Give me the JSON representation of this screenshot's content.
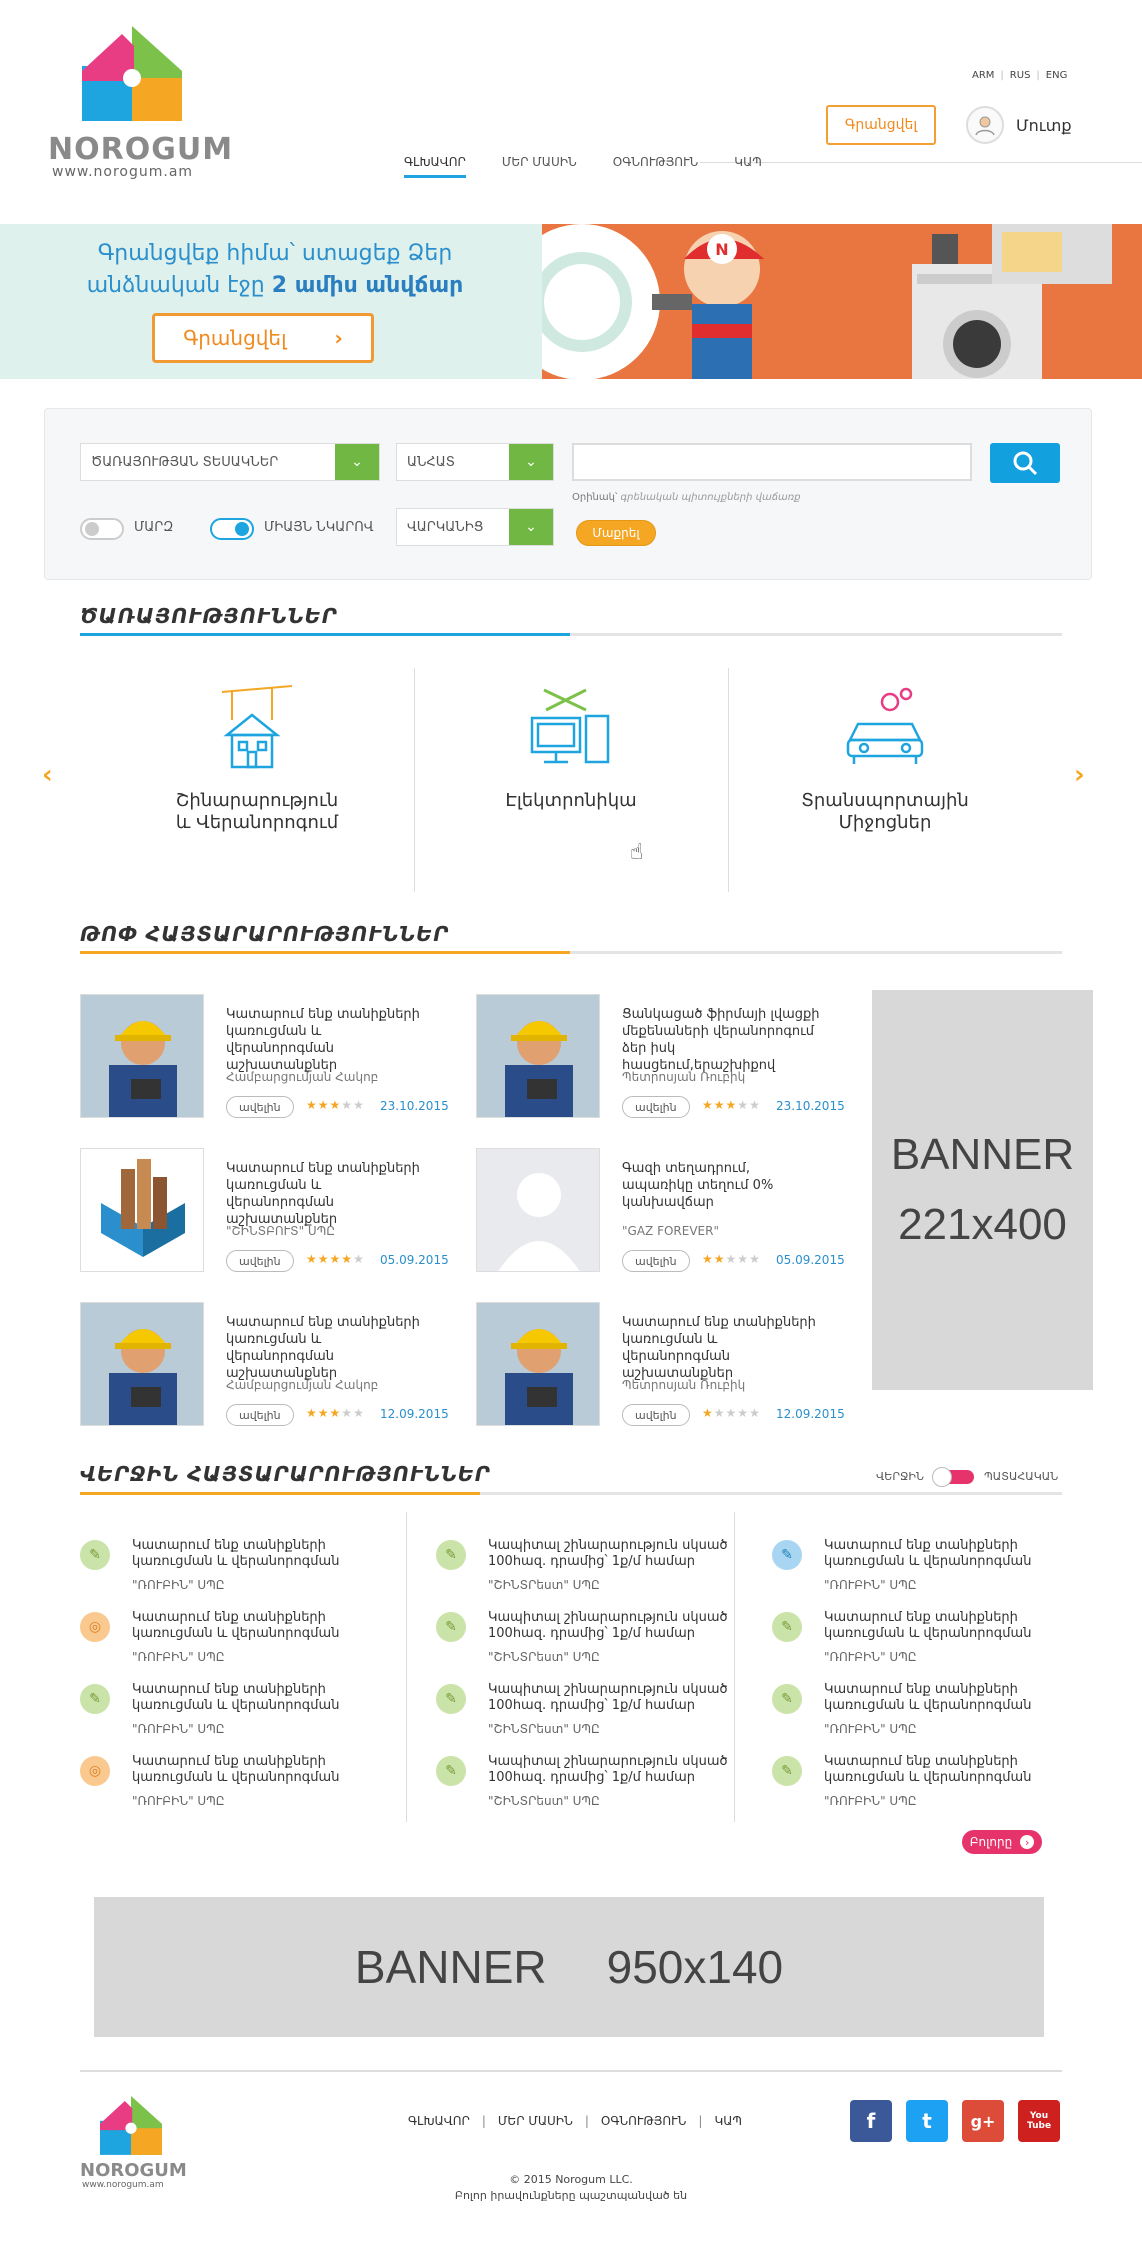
{
  "header": {
    "logo_text": "NOROGUM",
    "logo_url": "www.norogum.am",
    "langs": [
      "ARM",
      "RUS",
      "ENG"
    ],
    "register_label": "Գրանցվել",
    "login_label": "Մուտք",
    "nav": [
      "ԳԼԽԱՎՈՐ",
      "ՄԵՐ ՄԱՍԻՆ",
      "ՕԳՆՈՒԹՅՈՒՆ",
      "ԿԱՊ"
    ]
  },
  "hero": {
    "line1": "Գրանցվեք հիմա՝ ստացեք Ձեր",
    "line2_a": "անձնական էջը",
    "line2_b": "2 ամիս անվճար",
    "button": "Գրանցվել",
    "badge": "N"
  },
  "search": {
    "service_types": "ԾԱՌԱՅՈՒԹՅԱՆ ՏԵՍԱԿՆԵՐ",
    "region": "ԱՆՀԱՏ",
    "duration": "ՎԱՐԿԱՆԻՑ",
    "input_value": "",
    "hint_label": "Օրինակ՝",
    "hint_text": "գրենական պիտույքների վաճառք",
    "find_label": "Մաքրել",
    "toggle1_label": "ՄԱՐԶ",
    "toggle2_label": "ՄԻԱՅՆ ՆԿԱՐՈՎ"
  },
  "services": {
    "title": "ԾԱՌԱՅՈՒԹՅՈՒՆՆԵՐ",
    "items": [
      {
        "line1": "Շինարարություն",
        "line2": "և Վերանորոգում",
        "icon": "construction-icon"
      },
      {
        "line1": "Էլեկտրոնիկա",
        "line2": "",
        "icon": "electronics-icon"
      },
      {
        "line1": "Տրանսպորտային",
        "line2": "Միջոցներ",
        "icon": "car-icon"
      }
    ]
  },
  "top_ads": {
    "title": "ԹՈՓ ՀԱՅՏԱՐԱՐՈՒԹՅՈՒՆՆԵՐ",
    "more_label": "ավելին",
    "items": [
      {
        "title": "Կատարում ենք տանիքների կառուցման և վերանորոգման աշխատանքներ",
        "author": "Համբարցումյան Հակոբ",
        "stars": 3,
        "date": "23.10.2015",
        "thumb": "worker"
      },
      {
        "title": "Ցանկացած ֆիրմայի լվացքի մեքենաների վերանորոգում ձեր իսկ հասցեում,երաշխիքով",
        "author": "Պետրոսյան Ռուբիկ",
        "stars": 3,
        "date": "23.10.2015",
        "thumb": "worker"
      },
      {
        "title": "Կատարում ենք տանիքների կառուցման և վերանորոգման աշխատանքներ",
        "author": "\"ՇԻՆՏԲՈՒՏ\" ՍՊԸ",
        "stars": 4,
        "date": "05.09.2015",
        "thumb": "logo"
      },
      {
        "title": "Գազի տեղադրում, ապառիկը տեղում 0% կանխավճար",
        "author": "\"GAZ FOREVER\"",
        "stars": 2,
        "date": "05.09.2015",
        "thumb": "placeholder"
      },
      {
        "title": "Կատարում ենք տանիքների կառուցման և վերանորոգման աշխատանքներ",
        "author": "Համբարցումյան Հակոբ",
        "stars": 3,
        "date": "12.09.2015",
        "thumb": "worker"
      },
      {
        "title": "Կատարում ենք տանիքների կառուցման և վերանորոգման աշխատանքներ",
        "author": "Պետրոսյան Ռուբիկ",
        "stars": 1,
        "date": "12.09.2015",
        "thumb": "worker"
      }
    ],
    "banner_line1": "BANNER",
    "banner_line2": "221x400"
  },
  "recent": {
    "title": "ՎԵՐՋԻՆ ՀԱՅՏԱՐԱՐՈՒԹՅՈՒՆՆԵՐ",
    "toggle_left": "ՎԵՐՋԻՆ",
    "toggle_right": "ՊԱՏԱՀԱԿԱՆ",
    "more_label": "Բոլորը",
    "columns": [
      [
        {
          "title": "Կատարում ենք տանիքների կառուցման և վերանորոգման",
          "company": "\"ՌՈՒԲԻՆ\" ՍՊԸ",
          "icon": "tool"
        },
        {
          "title": "Կատարում ենք տանիքների կառուցման և վերանորոգման",
          "company": "\"ՌՈՒԲԻՆ\" ՍՊԸ",
          "icon": "target"
        },
        {
          "title": "Կատարում ենք տանիքների կառուցման և վերանորոգման",
          "company": "\"ՌՈՒԲԻՆ\" ՍՊԸ",
          "icon": "tool"
        },
        {
          "title": "Կատարում ենք տանիքների կառուցման և վերանորոգման",
          "company": "\"ՌՈՒԲԻՆ\" ՍՊԸ",
          "icon": "target"
        }
      ],
      [
        {
          "title": "Կապիտալ շինարարություն սկսած 100հազ. դրամից՝ 1ք/մ համար",
          "company": "\"ՇԻՆՏՐեստ\" ՍՊԸ",
          "icon": "tool"
        },
        {
          "title": "Կապիտալ շինարարություն սկսած 100հազ. դրամից՝ 1ք/մ համար",
          "company": "\"ՇԻՆՏՐեստ\" ՍՊԸ",
          "icon": "tool"
        },
        {
          "title": "Կապիտալ շինարարություն սկսած 100հազ. դրամից՝ 1ք/մ համար",
          "company": "\"ՇԻՆՏՐեստ\" ՍՊԸ",
          "icon": "tool"
        },
        {
          "title": "Կապիտալ շինարարություն սկսած 100հազ. դրամից՝ 1ք/մ համար",
          "company": "\"ՇԻՆՏՐեստ\" ՍՊԸ",
          "icon": "tool"
        }
      ],
      [
        {
          "title": "Կատարում ենք տանիքների կառուցման և վերանորոգման",
          "company": "\"ՌՈՒԲԻՆ\" ՍՊԸ",
          "icon": "brush"
        },
        {
          "title": "Կատարում ենք տանիքների կառուցման և վերանորոգման",
          "company": "\"ՌՈՒԲԻՆ\" ՍՊԸ",
          "icon": "tool"
        },
        {
          "title": "Կատարում ենք տանիքների կառուցման և վերանորոգման",
          "company": "\"ՌՈՒԲԻՆ\" ՍՊԸ",
          "icon": "tool"
        },
        {
          "title": "Կատարում ենք տանիքների կառուցման և վերանորոգման",
          "company": "\"ՌՈՒԲԻՆ\" ՍՊԸ",
          "icon": "tool"
        }
      ]
    ]
  },
  "banner2": {
    "word": "BANNER",
    "size": "950x140"
  },
  "footer": {
    "nav": [
      "ԳԼԽԱՎՈՐ",
      "ՄԵՐ ՄԱՍԻՆ",
      "ՕԳՆՈՒԹՅՈՒՆ",
      "ԿԱՊ"
    ],
    "copyright": "© 2015 Norogum LLC.",
    "rights": "Բոլոր իրավունքները պաշտպանված են",
    "social": [
      {
        "name": "facebook",
        "glyph": "f",
        "color": "#3b5998"
      },
      {
        "name": "twitter",
        "glyph": "t",
        "color": "#1da1f2"
      },
      {
        "name": "google-plus",
        "glyph": "g+",
        "color": "#dd4b39"
      },
      {
        "name": "youtube",
        "glyph": "You Tube",
        "color": "#cd201f"
      }
    ]
  },
  "colors": {
    "accent_blue": "#1ea5e0",
    "accent_orange": "#f5a623",
    "green": "#71b743",
    "pink": "#e6336b"
  }
}
